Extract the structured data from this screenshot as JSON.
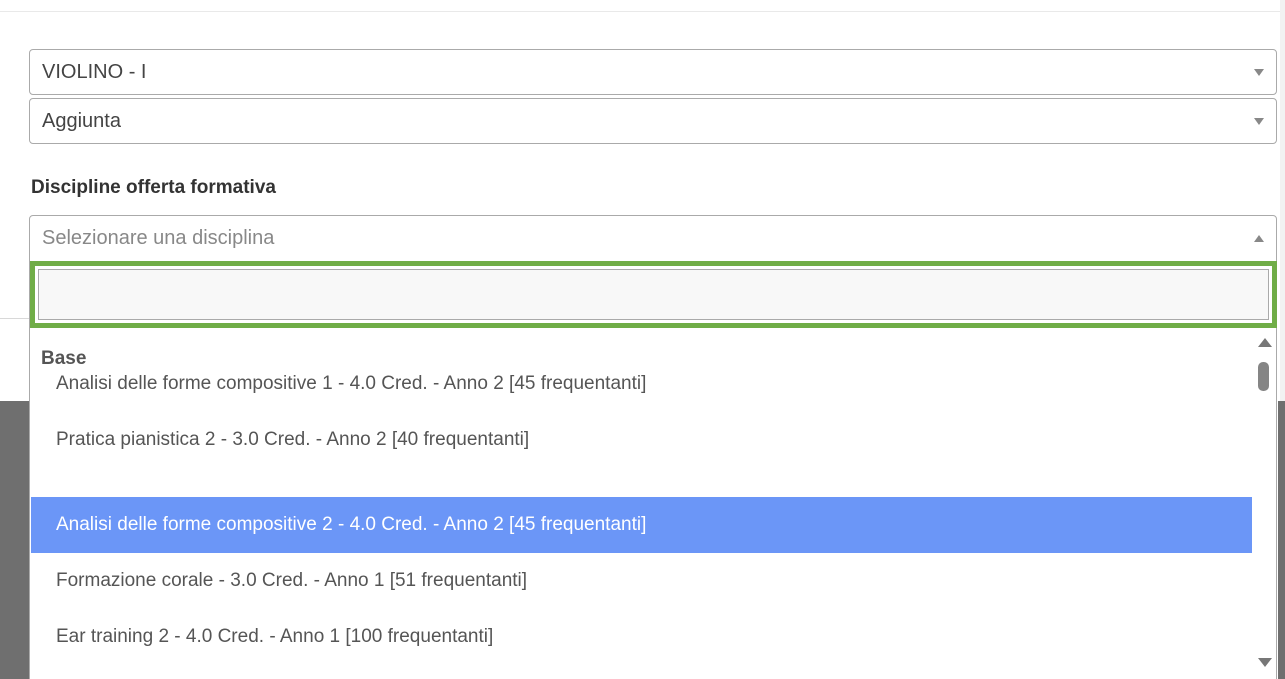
{
  "selects": {
    "instrument": {
      "value": "VIOLINO - I"
    },
    "type": {
      "value": "Aggiunta"
    }
  },
  "disciplines": {
    "label": "Discipline offerta formativa",
    "placeholder": "Selezionare una disciplina",
    "search": {
      "value": "",
      "placeholder": ""
    },
    "group": "Base",
    "options": [
      {
        "label": "Analisi delle forme compositive 1 - 4.0 Cred. - Anno 2 [45 frequentanti]",
        "highlighted": false
      },
      {
        "label": "Pratica pianistica 2 - 3.0 Cred. - Anno 2 [40 frequentanti]",
        "highlighted": false
      },
      {
        "label": "Analisi delle forme compositive 2 - 4.0 Cred. - Anno 2 [45 frequentanti]",
        "highlighted": true
      },
      {
        "label": "Formazione corale - 3.0 Cred. - Anno 1 [51 frequentanti]",
        "highlighted": false
      },
      {
        "label": "Ear training 2 - 4.0 Cred. - Anno 1 [100 frequentanti]",
        "highlighted": false
      }
    ]
  },
  "colors": {
    "highlight": "#6b96f7",
    "focus_outline": "#70ad47",
    "border": "#aaaaaa"
  },
  "icons": {
    "select_arrow": "caret-down-icon",
    "open_arrow": "caret-up-icon",
    "scroll_up": "scroll-up-arrow-icon",
    "scroll_down": "scroll-down-arrow-icon"
  }
}
